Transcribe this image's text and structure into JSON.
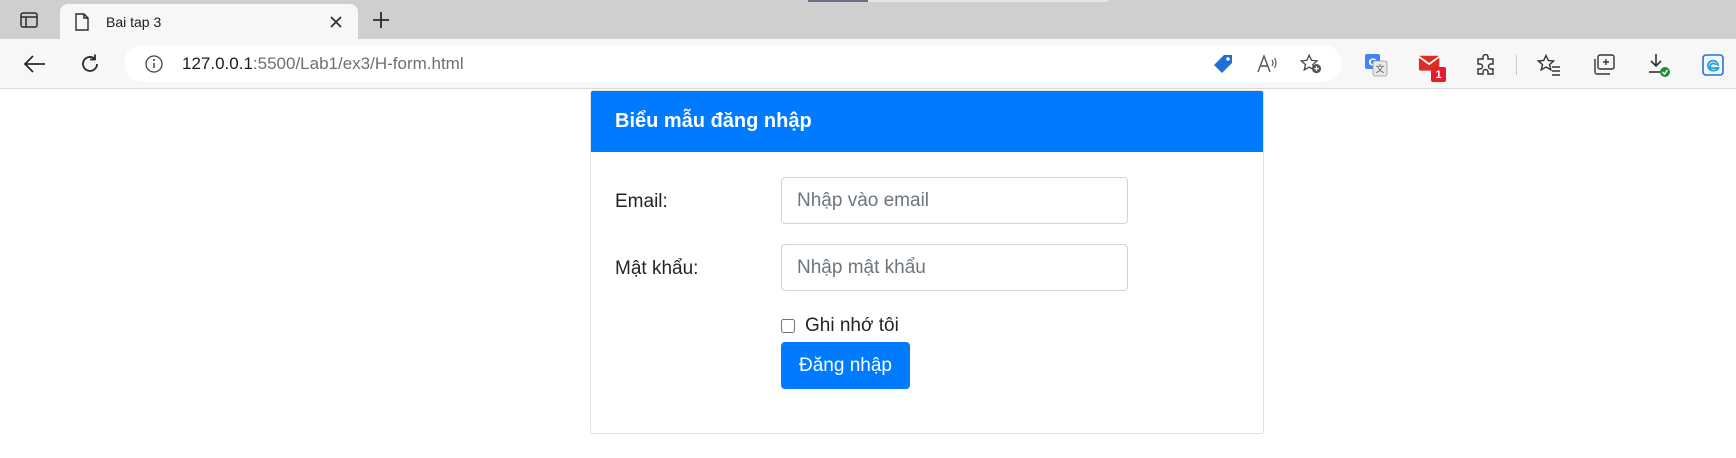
{
  "browser": {
    "tab": {
      "title": "Bai tap 3"
    },
    "address": {
      "host": "127.0.0.1",
      "path": ":5500/Lab1/ex3/H-form.html"
    },
    "mail_badge_count": "1",
    "icons": [
      "tab-actions-icon",
      "page-icon",
      "close-icon",
      "plus-icon",
      "back-icon",
      "refresh-icon",
      "info-icon",
      "tag-icon",
      "read-aloud-icon",
      "favorite-add-icon",
      "translate-icon",
      "mail-icon",
      "extensions-icon",
      "favorites-icon",
      "collections-icon",
      "downloads-icon",
      "edge-bar-icon"
    ]
  },
  "form": {
    "header": "Biểu mẫu đăng nhập",
    "email_label": "Email:",
    "email_placeholder": "Nhập vào email",
    "password_label": "Mật khẩu:",
    "password_placeholder": "Nhập mật khẩu",
    "remember_label": "Ghi nhớ tôi",
    "remember_checked": false,
    "submit_label": "Đăng nhập"
  },
  "colors": {
    "primary": "#007bff",
    "tabstrip": "#cfcfcf",
    "toolbar": "#f7f7f7",
    "badge": "#e11d2e"
  }
}
